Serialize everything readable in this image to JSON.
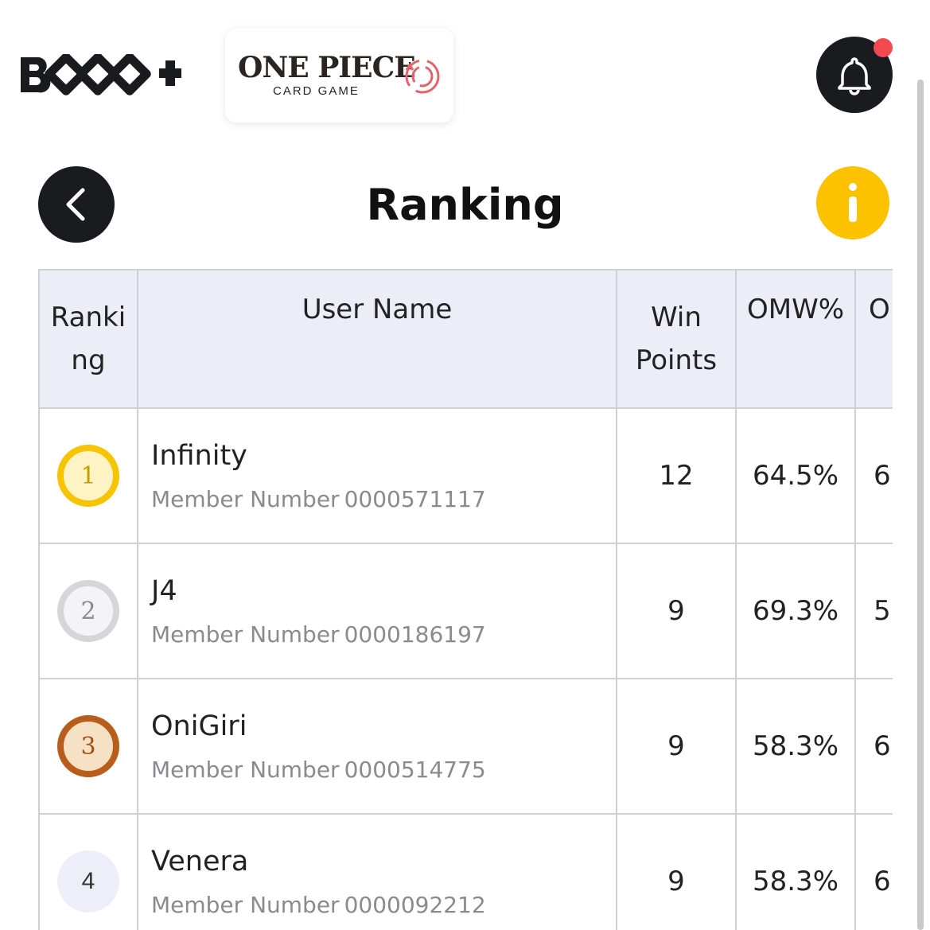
{
  "header": {
    "brand_logo_text": "BTCG+",
    "game_title": "ONE PIECE",
    "game_subtitle": "CARD GAME",
    "notification_icon": "bell-icon",
    "notification_color": "#f2484f"
  },
  "page": {
    "title": "Ranking",
    "back_icon": "chevron-left-icon",
    "info_icon": "info-icon",
    "accent_yellow": "#fcc200"
  },
  "table": {
    "columns": [
      "Ranking",
      "User Name",
      "Win Points",
      "OMW%",
      "O"
    ],
    "member_label": "Member Number",
    "rows": [
      {
        "rank": "1",
        "name": "Infinity",
        "member_number": "0000571117",
        "win_points": "12",
        "omw": "64.5%",
        "next": "6."
      },
      {
        "rank": "2",
        "name": "J4",
        "member_number": "0000186197",
        "win_points": "9",
        "omw": "69.3%",
        "next": "5:"
      },
      {
        "rank": "3",
        "name": "OniGiri",
        "member_number": "0000514775",
        "win_points": "9",
        "omw": "58.3%",
        "next": "6!"
      },
      {
        "rank": "4",
        "name": "Venera",
        "member_number": "0000092212",
        "win_points": "9",
        "omw": "58.3%",
        "next": "6("
      }
    ]
  }
}
